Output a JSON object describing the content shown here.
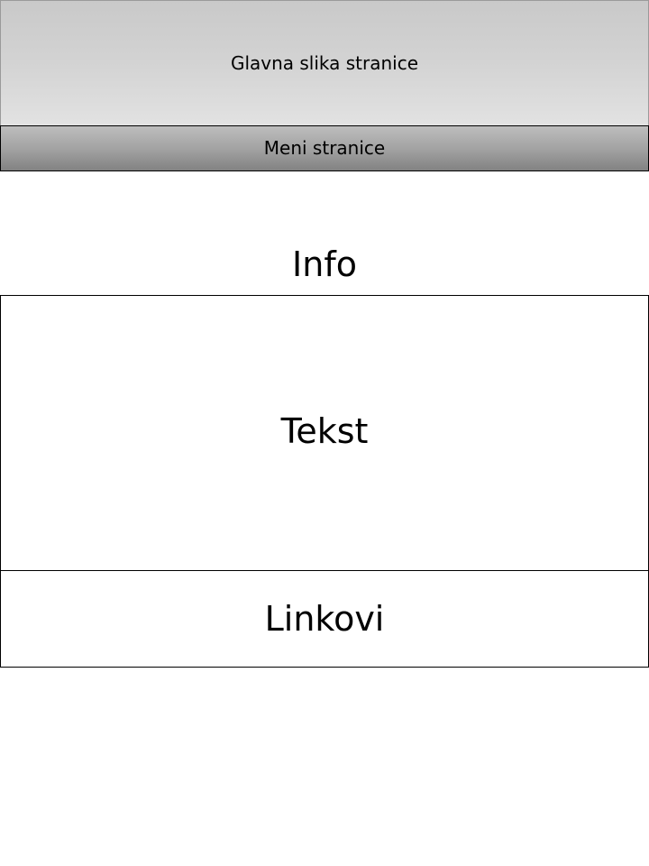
{
  "hero": {
    "label": "Glavna slika stranice"
  },
  "menu": {
    "label": "Meni stranice"
  },
  "info": {
    "label": "Info"
  },
  "content": {
    "label": "Tekst"
  },
  "links": {
    "label": "Linkovi"
  },
  "colors": {
    "hero_fill_top": "#c9c9c9",
    "hero_fill_bottom": "#e2e2e2",
    "menu_fill_top": "#bdbdbd",
    "menu_fill_bottom": "#828282",
    "border": "#000000",
    "background": "#ffffff"
  }
}
